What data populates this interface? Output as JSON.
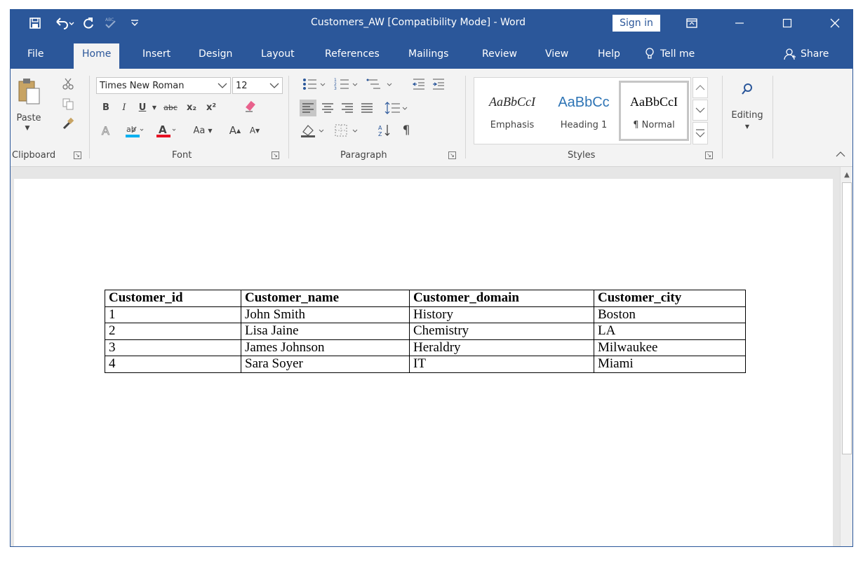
{
  "titlebar": {
    "title": "Customers_AW [Compatibility Mode]  -  Word",
    "sign_in": "Sign in"
  },
  "tabs": [
    {
      "label": "File"
    },
    {
      "label": "Home",
      "active": true
    },
    {
      "label": "Insert"
    },
    {
      "label": "Design"
    },
    {
      "label": "Layout"
    },
    {
      "label": "References"
    },
    {
      "label": "Mailings"
    },
    {
      "label": "Review"
    },
    {
      "label": "View"
    },
    {
      "label": "Help"
    },
    {
      "label": "Tell me"
    }
  ],
  "share_label": "Share",
  "ribbon": {
    "clipboard": {
      "paste_label": "Paste",
      "group_label": "Clipboard"
    },
    "font": {
      "font_name": "Times New Roman",
      "font_size": "12",
      "group_label": "Font",
      "bold": "B",
      "italic": "I",
      "underline": "U",
      "strikethrough": "abc",
      "subscript": "x₂",
      "superscript": "x²",
      "change_case": "Aa",
      "grow_font": "A",
      "shrink_font": "A"
    },
    "paragraph": {
      "group_label": "Paragraph",
      "pilcrow": "¶"
    },
    "styles": {
      "group_label": "Styles",
      "items": [
        {
          "sample": "AaBbCcI",
          "name": "Emphasis"
        },
        {
          "sample": "AaBbCc",
          "name": "Heading 1"
        },
        {
          "sample": "AaBbCcI",
          "name": "¶ Normal"
        }
      ]
    },
    "editing": {
      "label": "Editing"
    }
  },
  "document": {
    "table": {
      "headers": [
        "Customer_id",
        "Customer_name",
        "Customer_domain",
        "Customer_city"
      ],
      "rows": [
        [
          "1",
          "John Smith",
          "History",
          "Boston"
        ],
        [
          "2",
          "Lisa Jaine",
          "Chemistry",
          "LA"
        ],
        [
          "3",
          "James Johnson",
          "Heraldry",
          "Milwaukee"
        ],
        [
          "4",
          "Sara Soyer",
          "IT",
          "Miami"
        ]
      ]
    }
  },
  "colors": {
    "accent": "#2b579a",
    "ribbon_bg": "#f3f3f3",
    "font_color_bar": "#e81123",
    "highlight_bar": "#00b0f0"
  }
}
